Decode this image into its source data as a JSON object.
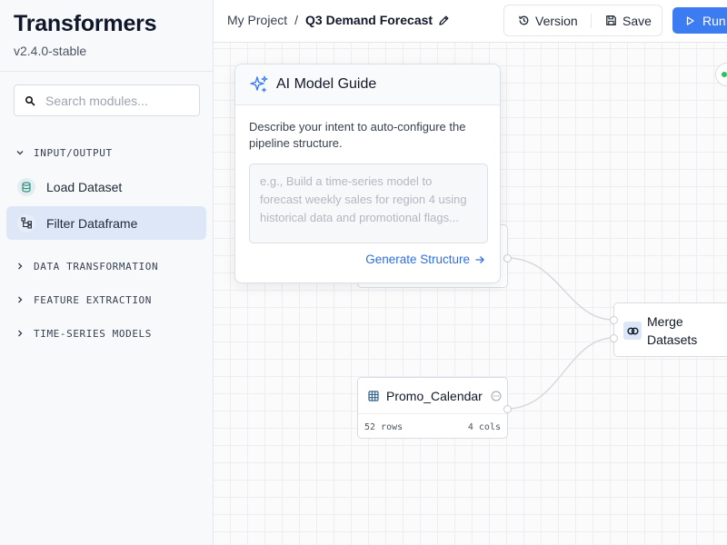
{
  "brand": {
    "title": "Transformers",
    "version": "v2.4.0-stable"
  },
  "search": {
    "placeholder": "Search modules..."
  },
  "sidebar": {
    "sections": [
      {
        "label": "INPUT/OUTPUT",
        "expanded": true
      },
      {
        "label": "DATA TRANSFORMATION",
        "expanded": false
      },
      {
        "label": "FEATURE EXTRACTION",
        "expanded": false
      },
      {
        "label": "TIME-SERIES MODELS",
        "expanded": false
      }
    ],
    "items": [
      {
        "label": "Load Dataset",
        "icon": "database-icon",
        "active": false
      },
      {
        "label": "Filter Dataframe",
        "icon": "hierarchy-icon",
        "active": true
      }
    ]
  },
  "breadcrumb": {
    "root": "My Project",
    "separator": "/",
    "current": "Q3 Demand Forecast"
  },
  "toolbar": {
    "version_label": "Version",
    "save_label": "Save",
    "run_label": "Run"
  },
  "ai_guide": {
    "title": "AI Model Guide",
    "description": "Describe your intent to auto-configure the pipeline structure.",
    "placeholder": "e.g., Build a time-series model to forecast weekly sales for region 4 using historical data and promotional flags...",
    "generate_label": "Generate Structure"
  },
  "nodes": {
    "promo": {
      "title": "Promo_Calendar",
      "rows": "52 rows",
      "cols": "4 cols"
    },
    "merge": {
      "title_line1": "Merge",
      "title_line2": "Datasets"
    }
  },
  "colors": {
    "accent": "#3b7cf2",
    "link": "#2f6fdd",
    "active_bg": "#dde7f7",
    "icon_teal": "#2f8f7f",
    "node_icon_bg": "#dbe6f7"
  }
}
